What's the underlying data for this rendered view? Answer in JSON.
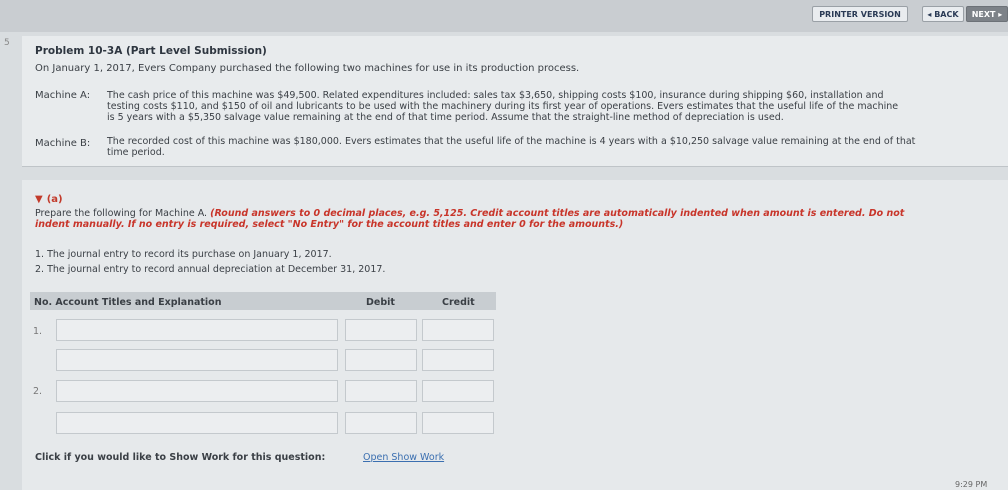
{
  "toolbar": {
    "print_label": "PRINTER VERSION",
    "back_label": "◂ BACK",
    "next_label": "NEXT ▸"
  },
  "margin_number": "5",
  "problem": {
    "title": "Problem 10-3A (Part Level Submission)",
    "intro": "On January 1, 2017, Evers Company purchased the following two machines for use in its production process.",
    "machine_a_label": "Machine A:",
    "machine_a_lines": [
      "The cash price of this machine was $49,500. Related expenditures included: sales tax $3,650, shipping costs $100, insurance during shipping $60, installation and",
      "testing costs $110, and $150 of oil and lubricants to be used with the machinery during its first year of operations. Evers estimates that the useful life of the machine",
      "is 5 years with a $5,350 salvage value remaining at the end of that time period. Assume that the straight-line method of depreciation is used."
    ],
    "machine_b_label": "Machine B:",
    "machine_b_lines": [
      "The recorded cost of this machine was $180,000. Evers estimates that the useful life of the machine is 4 years with a $10,250 salvage value remaining at the end of that",
      "time period."
    ]
  },
  "part_a": {
    "heading": "(a)",
    "instruction_prefix": "Prepare the following for Machine A. ",
    "instruction_red_1": "(Round answers to 0 decimal places, e.g. 5,125. Credit account titles are automatically indented when amount is entered. Do not",
    "instruction_red_2": "indent manually. If no entry is required, select \"No Entry\" for the account titles and enter 0 for the amounts.)",
    "items": [
      "1.  The journal entry to record its purchase on January 1, 2017.",
      "2.  The journal entry to record annual depreciation at December 31, 2017."
    ]
  },
  "table": {
    "headers": {
      "no_account": "No.  Account Titles and Explanation",
      "debit": "Debit",
      "credit": "Credit"
    },
    "row_numbers": [
      "1.",
      "2."
    ]
  },
  "show_work": {
    "question": "Click if you would like to Show Work for this question:",
    "link": "Open Show Work"
  },
  "clock": "9:29 PM"
}
